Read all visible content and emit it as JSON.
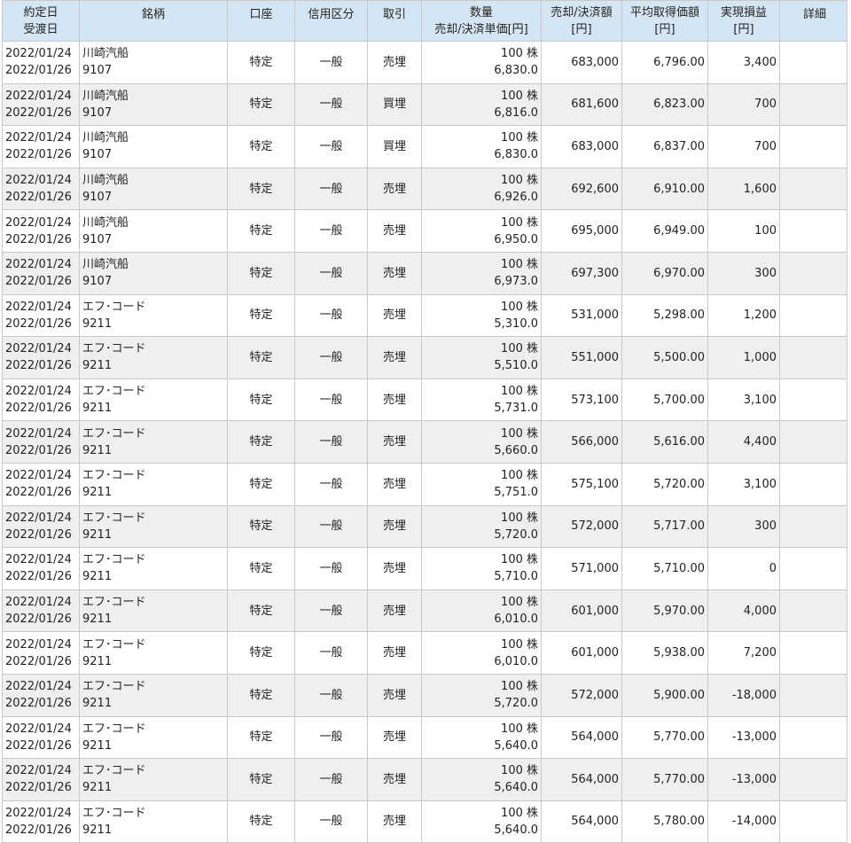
{
  "headers": {
    "date_trade": "約定日",
    "date_settle": "受渡日",
    "stock": "銘柄",
    "account": "口座",
    "credit_type": "信用区分",
    "trade": "取引",
    "qty": "数量",
    "unit_price": "売却/決済単価[円]",
    "amount": "売却/決済額",
    "amount_unit": "[円]",
    "avg_cost": "平均取得価額",
    "avg_cost_unit": "[円]",
    "pnl": "実現損益",
    "pnl_unit": "[円]",
    "detail": "詳細"
  },
  "rows": [
    {
      "trade_date": "2022/01/24",
      "settle_date": "2022/01/26",
      "name": "川崎汽船",
      "code": "9107",
      "account": "特定",
      "credit": "一般",
      "trade": "売埋",
      "qty": "100 株",
      "price": "6,830.0",
      "amount": "683,000",
      "avg": "6,796.00",
      "pnl": "3,400"
    },
    {
      "trade_date": "2022/01/24",
      "settle_date": "2022/01/26",
      "name": "川崎汽船",
      "code": "9107",
      "account": "特定",
      "credit": "一般",
      "trade": "買埋",
      "qty": "100 株",
      "price": "6,816.0",
      "amount": "681,600",
      "avg": "6,823.00",
      "pnl": "700"
    },
    {
      "trade_date": "2022/01/24",
      "settle_date": "2022/01/26",
      "name": "川崎汽船",
      "code": "9107",
      "account": "特定",
      "credit": "一般",
      "trade": "買埋",
      "qty": "100 株",
      "price": "6,830.0",
      "amount": "683,000",
      "avg": "6,837.00",
      "pnl": "700"
    },
    {
      "trade_date": "2022/01/24",
      "settle_date": "2022/01/26",
      "name": "川崎汽船",
      "code": "9107",
      "account": "特定",
      "credit": "一般",
      "trade": "売埋",
      "qty": "100 株",
      "price": "6,926.0",
      "amount": "692,600",
      "avg": "6,910.00",
      "pnl": "1,600"
    },
    {
      "trade_date": "2022/01/24",
      "settle_date": "2022/01/26",
      "name": "川崎汽船",
      "code": "9107",
      "account": "特定",
      "credit": "一般",
      "trade": "売埋",
      "qty": "100 株",
      "price": "6,950.0",
      "amount": "695,000",
      "avg": "6,949.00",
      "pnl": "100"
    },
    {
      "trade_date": "2022/01/24",
      "settle_date": "2022/01/26",
      "name": "川崎汽船",
      "code": "9107",
      "account": "特定",
      "credit": "一般",
      "trade": "売埋",
      "qty": "100 株",
      "price": "6,973.0",
      "amount": "697,300",
      "avg": "6,970.00",
      "pnl": "300"
    },
    {
      "trade_date": "2022/01/24",
      "settle_date": "2022/01/26",
      "name": "エフ･コード",
      "code": "9211",
      "account": "特定",
      "credit": "一般",
      "trade": "売埋",
      "qty": "100 株",
      "price": "5,310.0",
      "amount": "531,000",
      "avg": "5,298.00",
      "pnl": "1,200"
    },
    {
      "trade_date": "2022/01/24",
      "settle_date": "2022/01/26",
      "name": "エフ･コード",
      "code": "9211",
      "account": "特定",
      "credit": "一般",
      "trade": "売埋",
      "qty": "100 株",
      "price": "5,510.0",
      "amount": "551,000",
      "avg": "5,500.00",
      "pnl": "1,000"
    },
    {
      "trade_date": "2022/01/24",
      "settle_date": "2022/01/26",
      "name": "エフ･コード",
      "code": "9211",
      "account": "特定",
      "credit": "一般",
      "trade": "売埋",
      "qty": "100 株",
      "price": "5,731.0",
      "amount": "573,100",
      "avg": "5,700.00",
      "pnl": "3,100"
    },
    {
      "trade_date": "2022/01/24",
      "settle_date": "2022/01/26",
      "name": "エフ･コード",
      "code": "9211",
      "account": "特定",
      "credit": "一般",
      "trade": "売埋",
      "qty": "100 株",
      "price": "5,660.0",
      "amount": "566,000",
      "avg": "5,616.00",
      "pnl": "4,400"
    },
    {
      "trade_date": "2022/01/24",
      "settle_date": "2022/01/26",
      "name": "エフ･コード",
      "code": "9211",
      "account": "特定",
      "credit": "一般",
      "trade": "売埋",
      "qty": "100 株",
      "price": "5,751.0",
      "amount": "575,100",
      "avg": "5,720.00",
      "pnl": "3,100"
    },
    {
      "trade_date": "2022/01/24",
      "settle_date": "2022/01/26",
      "name": "エフ･コード",
      "code": "9211",
      "account": "特定",
      "credit": "一般",
      "trade": "売埋",
      "qty": "100 株",
      "price": "5,720.0",
      "amount": "572,000",
      "avg": "5,717.00",
      "pnl": "300"
    },
    {
      "trade_date": "2022/01/24",
      "settle_date": "2022/01/26",
      "name": "エフ･コード",
      "code": "9211",
      "account": "特定",
      "credit": "一般",
      "trade": "売埋",
      "qty": "100 株",
      "price": "5,710.0",
      "amount": "571,000",
      "avg": "5,710.00",
      "pnl": "0"
    },
    {
      "trade_date": "2022/01/24",
      "settle_date": "2022/01/26",
      "name": "エフ･コード",
      "code": "9211",
      "account": "特定",
      "credit": "一般",
      "trade": "売埋",
      "qty": "100 株",
      "price": "6,010.0",
      "amount": "601,000",
      "avg": "5,970.00",
      "pnl": "4,000"
    },
    {
      "trade_date": "2022/01/24",
      "settle_date": "2022/01/26",
      "name": "エフ･コード",
      "code": "9211",
      "account": "特定",
      "credit": "一般",
      "trade": "売埋",
      "qty": "100 株",
      "price": "6,010.0",
      "amount": "601,000",
      "avg": "5,938.00",
      "pnl": "7,200"
    },
    {
      "trade_date": "2022/01/24",
      "settle_date": "2022/01/26",
      "name": "エフ･コード",
      "code": "9211",
      "account": "特定",
      "credit": "一般",
      "trade": "売埋",
      "qty": "100 株",
      "price": "5,720.0",
      "amount": "572,000",
      "avg": "5,900.00",
      "pnl": "-18,000"
    },
    {
      "trade_date": "2022/01/24",
      "settle_date": "2022/01/26",
      "name": "エフ･コード",
      "code": "9211",
      "account": "特定",
      "credit": "一般",
      "trade": "売埋",
      "qty": "100 株",
      "price": "5,640.0",
      "amount": "564,000",
      "avg": "5,770.00",
      "pnl": "-13,000"
    },
    {
      "trade_date": "2022/01/24",
      "settle_date": "2022/01/26",
      "name": "エフ･コード",
      "code": "9211",
      "account": "特定",
      "credit": "一般",
      "trade": "売埋",
      "qty": "100 株",
      "price": "5,640.0",
      "amount": "564,000",
      "avg": "5,770.00",
      "pnl": "-13,000"
    },
    {
      "trade_date": "2022/01/24",
      "settle_date": "2022/01/26",
      "name": "エフ･コード",
      "code": "9211",
      "account": "特定",
      "credit": "一般",
      "trade": "売埋",
      "qty": "100 株",
      "price": "5,640.0",
      "amount": "564,000",
      "avg": "5,780.00",
      "pnl": "-14,000"
    }
  ],
  "colors": {
    "header_bg": "#d4e6f3",
    "row_alt_bg": "#efefef",
    "border": "#c9c9c9"
  }
}
